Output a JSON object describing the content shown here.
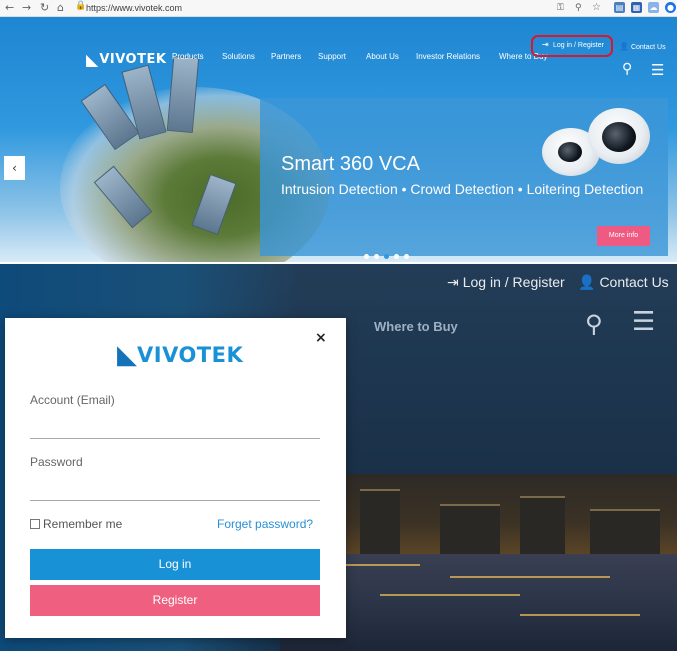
{
  "browser": {
    "back_icon": "arrow-left-icon",
    "forward_icon": "arrow-right-icon",
    "reload_icon": "reload-icon",
    "home_icon": "home-icon",
    "url": "https://www.vivotek.com"
  },
  "hero": {
    "logo_text": "VIVOTEK",
    "nav": [
      "Products",
      "Solutions",
      "Partners",
      "Support",
      "About Us",
      "Investor Relations",
      "Where to Buy"
    ],
    "login_label": "Log in / Register",
    "contact_label": "Contact Us",
    "promo": {
      "title": "Smart 360 VCA",
      "subtitle": "Intrusion Detection • Crowd Detection • Loitering Detection",
      "more_label": "More info"
    },
    "slide_count": 4,
    "active_slide": 3
  },
  "background_header": {
    "login_label": "Log in / Register",
    "contact_label": "Contact Us",
    "where_to_buy": "Where to Buy"
  },
  "modal": {
    "logo_text": "VIVOTEK",
    "close_label": "×",
    "account_label": "Account (Email)",
    "account_value": "",
    "password_label": "Password",
    "password_value": "",
    "remember_label": "Remember me",
    "remember_checked": false,
    "forgot_label": "Forget password?",
    "login_button": "Log in",
    "register_button": "Register"
  },
  "colors": {
    "brand_blue": "#1991d6",
    "register_pink": "#ef5f80",
    "highlight_red": "#d9182b"
  }
}
